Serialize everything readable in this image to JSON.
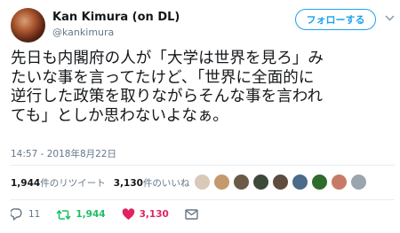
{
  "author": {
    "name": "Kan Kimura (on DL)",
    "handle": "@kankimura"
  },
  "follow_label": "フォローする",
  "tweet_lines": [
    "先日も内閣府の人が「大学は世界を見ろ」み",
    "たいな事を言ってたけど、「世界に全面的に",
    "逆行した政策を取りながらそんな事を言われ",
    "ても」としか思わないよなぁ。"
  ],
  "timestamp": "14:57 - 2018年8月22日",
  "stats": {
    "retweets_count": "1,944",
    "retweets_label": "件のリツイート",
    "likes_count": "3,130",
    "likes_label": "件のいいね"
  },
  "likers": [
    {
      "color": "#d8c9b8"
    },
    {
      "color": "#c49a6c"
    },
    {
      "color": "#6b5a48"
    },
    {
      "color": "#3d4a3a"
    },
    {
      "color": "#5e4d3f"
    },
    {
      "color": "#4a6b8a"
    },
    {
      "color": "#2f6b2a"
    },
    {
      "color": "#c77b67"
    },
    {
      "color": "#9aa5ad"
    }
  ],
  "actions": {
    "reply_count": "11",
    "retweet_count": "1,944",
    "like_count": "3,130"
  },
  "icons": {
    "caret": "chevron-down-icon",
    "reply": "reply-icon",
    "retweet": "retweet-icon",
    "like": "heart-icon",
    "dm": "envelope-icon"
  },
  "colors": {
    "accent": "#1da1f2",
    "retweet": "#17bf63",
    "like": "#e0245e",
    "muted": "#657786"
  }
}
